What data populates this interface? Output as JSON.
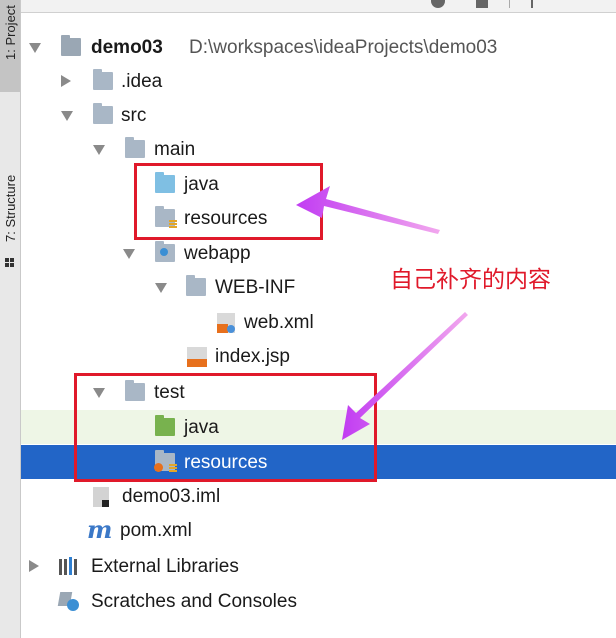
{
  "side_tabs": {
    "project": "1: Project",
    "structure": "7: Structure"
  },
  "tree": {
    "root": {
      "name": "demo03",
      "path": "D:\\workspaces\\ideaProjects\\demo03"
    },
    "idea": ".idea",
    "src": "src",
    "main": "main",
    "main_java": "java",
    "main_resources": "resources",
    "webapp": "webapp",
    "webinf": "WEB-INF",
    "webxml": "web.xml",
    "indexjsp": "index.jsp",
    "test": "test",
    "test_java": "java",
    "test_resources": "resources",
    "iml": "demo03.iml",
    "pom": "pom.xml",
    "external_libraries": "External Libraries",
    "scratches": "Scratches and Consoles"
  },
  "annotation": {
    "text": "自己补齐的内容"
  },
  "colors": {
    "selection": "#2265c7",
    "annotation": "#e0192a",
    "arrow": "#c13cf2",
    "highlight": "#eef6e6"
  }
}
